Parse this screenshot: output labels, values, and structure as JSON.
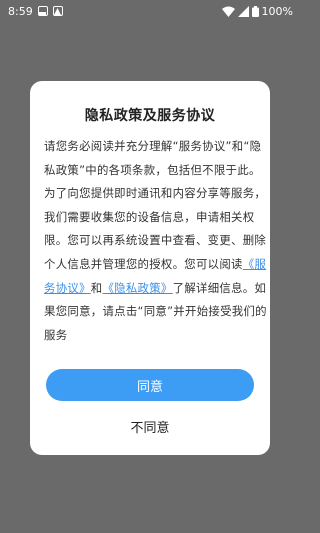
{
  "status_bar": {
    "time": "8:59",
    "battery": "100%"
  },
  "dialog": {
    "title": "隐私政策及服务协议",
    "lines": [
      "请您务必阅读并充分理解“服务协议”和“隐",
      "私政策”中的各项条款，包括但不限于此。",
      "为了向您提供即时通讯和内容分享等服务，",
      "我们需要收集您的设备信息，申请相关权",
      "限。您可以再系统设置中查看、变更、删除",
      "个人信息并管理您的授权。您可以阅读"
    ],
    "link_service_part1": "《服",
    "link_service_part2": "务协议》",
    "and_text": "和",
    "link_privacy": "《隐私政策》",
    "after_links": "了解详细信息。如",
    "line_after": "果您同意，请点击“同意”并开始接受我们的",
    "last_line": "服务",
    "agree_label": "同意",
    "disagree_label": "不同意"
  }
}
